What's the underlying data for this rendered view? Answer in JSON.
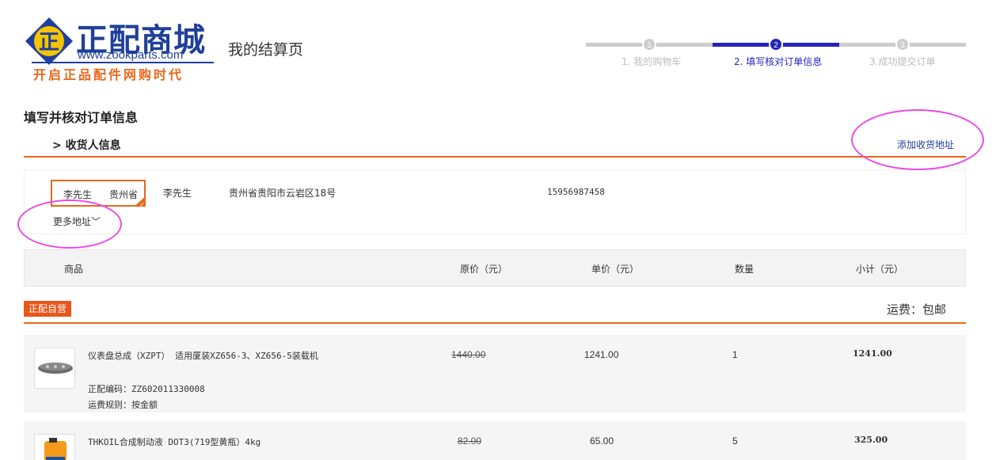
{
  "logo": {
    "brand": "正配商城",
    "url": "www.zookparts.com",
    "slogan": "开启正品配件网购时代",
    "mark_char": "正"
  },
  "page_subtitle": "我的结算页",
  "steps": [
    {
      "num": "1",
      "label": "1. 我的购物车",
      "active": false
    },
    {
      "num": "2",
      "label": "2. 填写核对订单信息",
      "active": true
    },
    {
      "num": "3",
      "label": "3.成功提交订单",
      "active": false
    }
  ],
  "section_title": "填写并核对订单信息",
  "consignee": {
    "heading": "> 收货人信息",
    "add_address": "添加收货地址",
    "selected_chip": {
      "name": "李先生",
      "province": "贵州省"
    },
    "name": "李先生",
    "address": "贵州省贵阳市云岩区18号",
    "phone": "15956987458",
    "more": "更多地址"
  },
  "table_headers": {
    "product": "商品",
    "original_price": "原价（元）",
    "unit_price": "单价（元）",
    "quantity": "数量",
    "subtotal": "小计（元）"
  },
  "shop": {
    "tag": "正配自营",
    "shipping": "运费：包邮"
  },
  "items": [
    {
      "name": "仪表盘总成（XZPT） 适用厦装XZ656-3、XZ656-5装载机",
      "code": "正配编码：ZZ602011330008",
      "rule": "运费规则：按金额",
      "original_price": "1440.00",
      "unit_price": "1241.00",
      "quantity": "1",
      "subtotal": "1241.00"
    },
    {
      "name": "THKOIL合成制动液 DOT3(719型黄瓶）4kg",
      "original_price": "82.00",
      "unit_price": "65.00",
      "quantity": "5",
      "subtotal": "325.00"
    }
  ],
  "colors": {
    "brand_blue": "#1f3f9a",
    "accent_orange": "#e8671b",
    "step_active": "#2424b8",
    "annotation": "#e84ae8"
  }
}
